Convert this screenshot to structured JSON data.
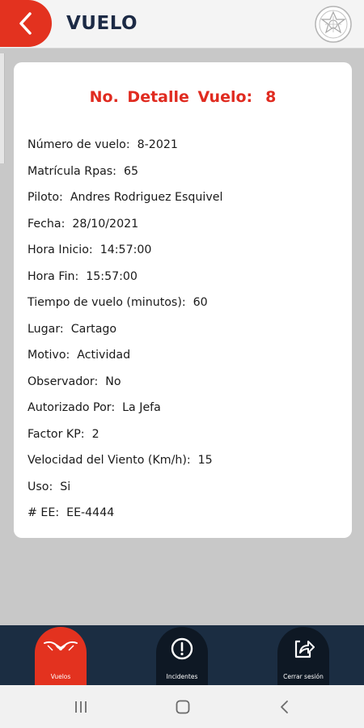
{
  "header": {
    "title": "VUELO"
  },
  "card": {
    "title_label": "No.  Detalle Vuelo:",
    "title_value": "8",
    "fields": [
      {
        "label": "Número de vuelo:",
        "value": "8-2021"
      },
      {
        "label": "Matrícula Rpas:",
        "value": "65"
      },
      {
        "label": "Piloto:",
        "value": "Andres Rodriguez Esquivel"
      },
      {
        "label": "Fecha:",
        "value": "28/10/2021"
      },
      {
        "label": "Hora Inicio:",
        "value": "14:57:00"
      },
      {
        "label": "Hora Fin:",
        "value": "15:57:00"
      },
      {
        "label": "Tiempo de vuelo (minutos):",
        "value": "60"
      },
      {
        "label": "Lugar:",
        "value": "Cartago"
      },
      {
        "label": "Motivo:",
        "value": "Actividad"
      },
      {
        "label": "Observador:",
        "value": "No"
      },
      {
        "label": "Autorizado Por:",
        "value": "La Jefa"
      },
      {
        "label": "Factor KP:",
        "value": "2"
      },
      {
        "label": "Velocidad del Viento (Km/h):",
        "value": "15"
      },
      {
        "label": "Uso:",
        "value": "Si"
      },
      {
        "label": "# EE:",
        "value": "EE-4444"
      }
    ]
  },
  "bottom_nav": {
    "items": [
      {
        "label": "Vuelos",
        "icon": "drone-icon",
        "active": true
      },
      {
        "label": "Incidentes",
        "icon": "alert-circle-icon",
        "active": false
      },
      {
        "label": "Cerrar sesión",
        "icon": "share-exit-icon",
        "active": false
      }
    ]
  },
  "colors": {
    "accent": "#e3321f",
    "title_red": "#e02b20",
    "nav_bg": "#1b2d42",
    "header_text": "#1c2a45"
  }
}
